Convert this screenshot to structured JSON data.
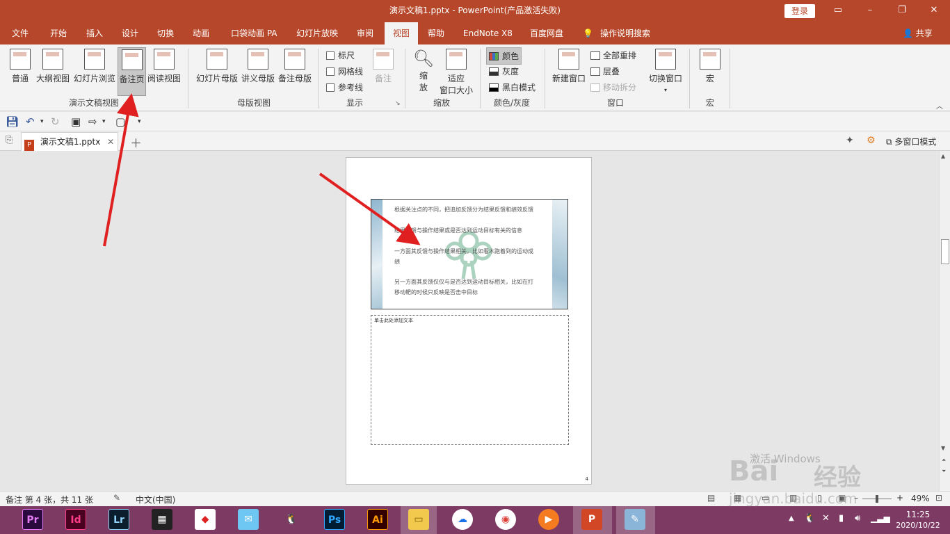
{
  "titlebar": {
    "title": "演示文稿1.pptx  -  PowerPoint(产品激活失败)",
    "login": "登录",
    "ribbon_display_icon": "ribbon-display-icon",
    "min": "–",
    "restore": "❐",
    "close": "✕"
  },
  "menu": {
    "items": [
      "文件",
      "开始",
      "插入",
      "设计",
      "切换",
      "动画",
      "口袋动画 PA",
      "幻灯片放映",
      "审阅",
      "视图",
      "帮助",
      "EndNote X8",
      "百度网盘",
      "操作说明搜索"
    ],
    "active": "视图",
    "share": "共享"
  },
  "ribbon": {
    "presentation_views": {
      "buttons": [
        "普通",
        "大纲视图",
        "幻灯片浏览",
        "备注页",
        "阅读视图"
      ],
      "selected": "备注页",
      "label": "演示文稿视图"
    },
    "master_views": {
      "buttons": [
        "幻灯片母版",
        "讲义母版",
        "备注母版"
      ],
      "label": "母版视图"
    },
    "show": {
      "ruler": "标尺",
      "gridlines": "网格线",
      "guides": "参考线",
      "notes": "备注",
      "label": "显示"
    },
    "zoom": {
      "zoom_top": "缩",
      "zoom_bottom": "放",
      "fit_top": "适应",
      "fit_bottom": "窗口大小",
      "label": "缩放"
    },
    "color": {
      "color": "颜色",
      "grayscale": "灰度",
      "bw": "黑白模式",
      "label": "颜色/灰度"
    },
    "window": {
      "new_window": "新建窗口",
      "arrange_all": "全部重排",
      "cascade": "层叠",
      "move_split": "移动拆分",
      "switch_window": "切换窗口",
      "label": "窗口"
    },
    "macro": {
      "macro": "宏",
      "label": "宏"
    }
  },
  "doc": {
    "tab": "演示文稿1.pptx",
    "multi_window": "多窗口模式"
  },
  "slide": {
    "lines": [
      "根据关注点的不同，把追加反馈分为结果反馈和绩效反馈",
      "结果反馈与操作结果或是否达到运动目标有关的信息",
      "一方面其反馈与操作结果相关，比如看木跑着到的运动成",
      "绩",
      "另一方面其反馈仅仅与是否达到运动目标相关，比如在打",
      "移动靶的时候只反映是否击中目标"
    ]
  },
  "notes": {
    "placeholder": "单击此处添加文本",
    "page_number": "4"
  },
  "status": {
    "page": "备注 第 4 张，共 11 张",
    "lang": "中文(中国)",
    "zoom": "49%",
    "minus": "–",
    "plus": "+"
  },
  "taskbar": {
    "apps": [
      "Pr",
      "Id",
      "Lr",
      "Ps",
      "Ai"
    ],
    "time": "11:25",
    "date": "2020/10/22"
  },
  "watermark": {
    "line1": "激活 Windows",
    "logo": "Bai",
    "logo2": "经验",
    "url": "jingyan.baidu.com"
  }
}
